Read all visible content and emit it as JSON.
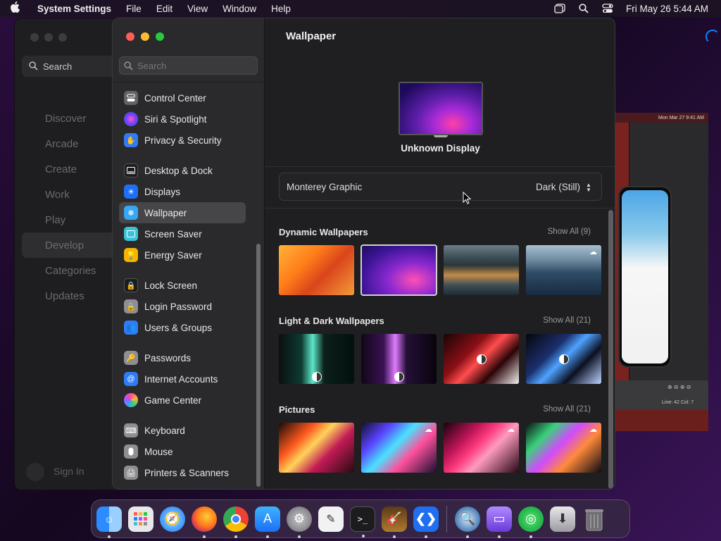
{
  "menubar": {
    "app_name": "System Settings",
    "menus": [
      "File",
      "Edit",
      "View",
      "Window",
      "Help"
    ],
    "datetime": "Fri May 26  5:44 AM"
  },
  "background_app": {
    "search_label": "Search",
    "nav": [
      "Discover",
      "Arcade",
      "Create",
      "Work",
      "Play",
      "Develop",
      "Categories",
      "Updates"
    ],
    "selected": "Develop",
    "sign_in": "Sign In"
  },
  "background_sim": {
    "status": "Mon Mar 27  9:41 AM",
    "footer": "Line: 42  Col: 7"
  },
  "sidebar": {
    "search_placeholder": "Search",
    "items": [
      {
        "label": "Control Center",
        "icon": "control-center-icon",
        "color": "#636366"
      },
      {
        "label": "Siri & Spotlight",
        "icon": "siri-icon",
        "color": "#7d3cff"
      },
      {
        "label": "Privacy & Security",
        "icon": "hand-icon",
        "color": "#2f7cf6"
      },
      {
        "label": "Desktop & Dock",
        "icon": "dock-icon",
        "color": "#1c1c1e"
      },
      {
        "label": "Displays",
        "icon": "sun-icon",
        "color": "#1e6ff5"
      },
      {
        "label": "Wallpaper",
        "icon": "wallpaper-icon",
        "color": "#35a7f5"
      },
      {
        "label": "Screen Saver",
        "icon": "screen-saver-icon",
        "color": "#3ac3d8"
      },
      {
        "label": "Energy Saver",
        "icon": "lightbulb-icon",
        "color": "#f5b400"
      },
      {
        "label": "Lock Screen",
        "icon": "lock-icon",
        "color": "#1c1c1e"
      },
      {
        "label": "Login Password",
        "icon": "password-lock-icon",
        "color": "#8e8e93"
      },
      {
        "label": "Users & Groups",
        "icon": "users-icon",
        "color": "#2f7cf6"
      },
      {
        "label": "Passwords",
        "icon": "key-icon",
        "color": "#8e8e93"
      },
      {
        "label": "Internet Accounts",
        "icon": "at-icon",
        "color": "#2f7cf6"
      },
      {
        "label": "Game Center",
        "icon": "game-center-icon",
        "color": "#ffffff"
      },
      {
        "label": "Keyboard",
        "icon": "keyboard-icon",
        "color": "#8e8e93"
      },
      {
        "label": "Mouse",
        "icon": "mouse-icon",
        "color": "#8e8e93"
      },
      {
        "label": "Printers & Scanners",
        "icon": "printer-icon",
        "color": "#8e8e93"
      }
    ],
    "selected": "Wallpaper"
  },
  "detail": {
    "title": "Wallpaper",
    "display_name": "Unknown Display",
    "current_wallpaper": "Monterey Graphic",
    "appearance_mode": "Dark (Still)",
    "sections": [
      {
        "title": "Dynamic Wallpapers",
        "show_all": "Show All (9)"
      },
      {
        "title": "Light & Dark Wallpapers",
        "show_all": "Show All (21)"
      },
      {
        "title": "Pictures",
        "show_all": "Show All (21)"
      }
    ]
  },
  "dock": {
    "apps": [
      "Finder",
      "Launchpad",
      "Safari",
      "Firefox",
      "Chrome",
      "App Store",
      "System Settings",
      "TextEdit",
      "Terminal",
      "Instruments",
      "Visual Studio Code",
      "Proxyman",
      "Simulator",
      "Find My",
      "Downloads",
      "Trash"
    ]
  }
}
